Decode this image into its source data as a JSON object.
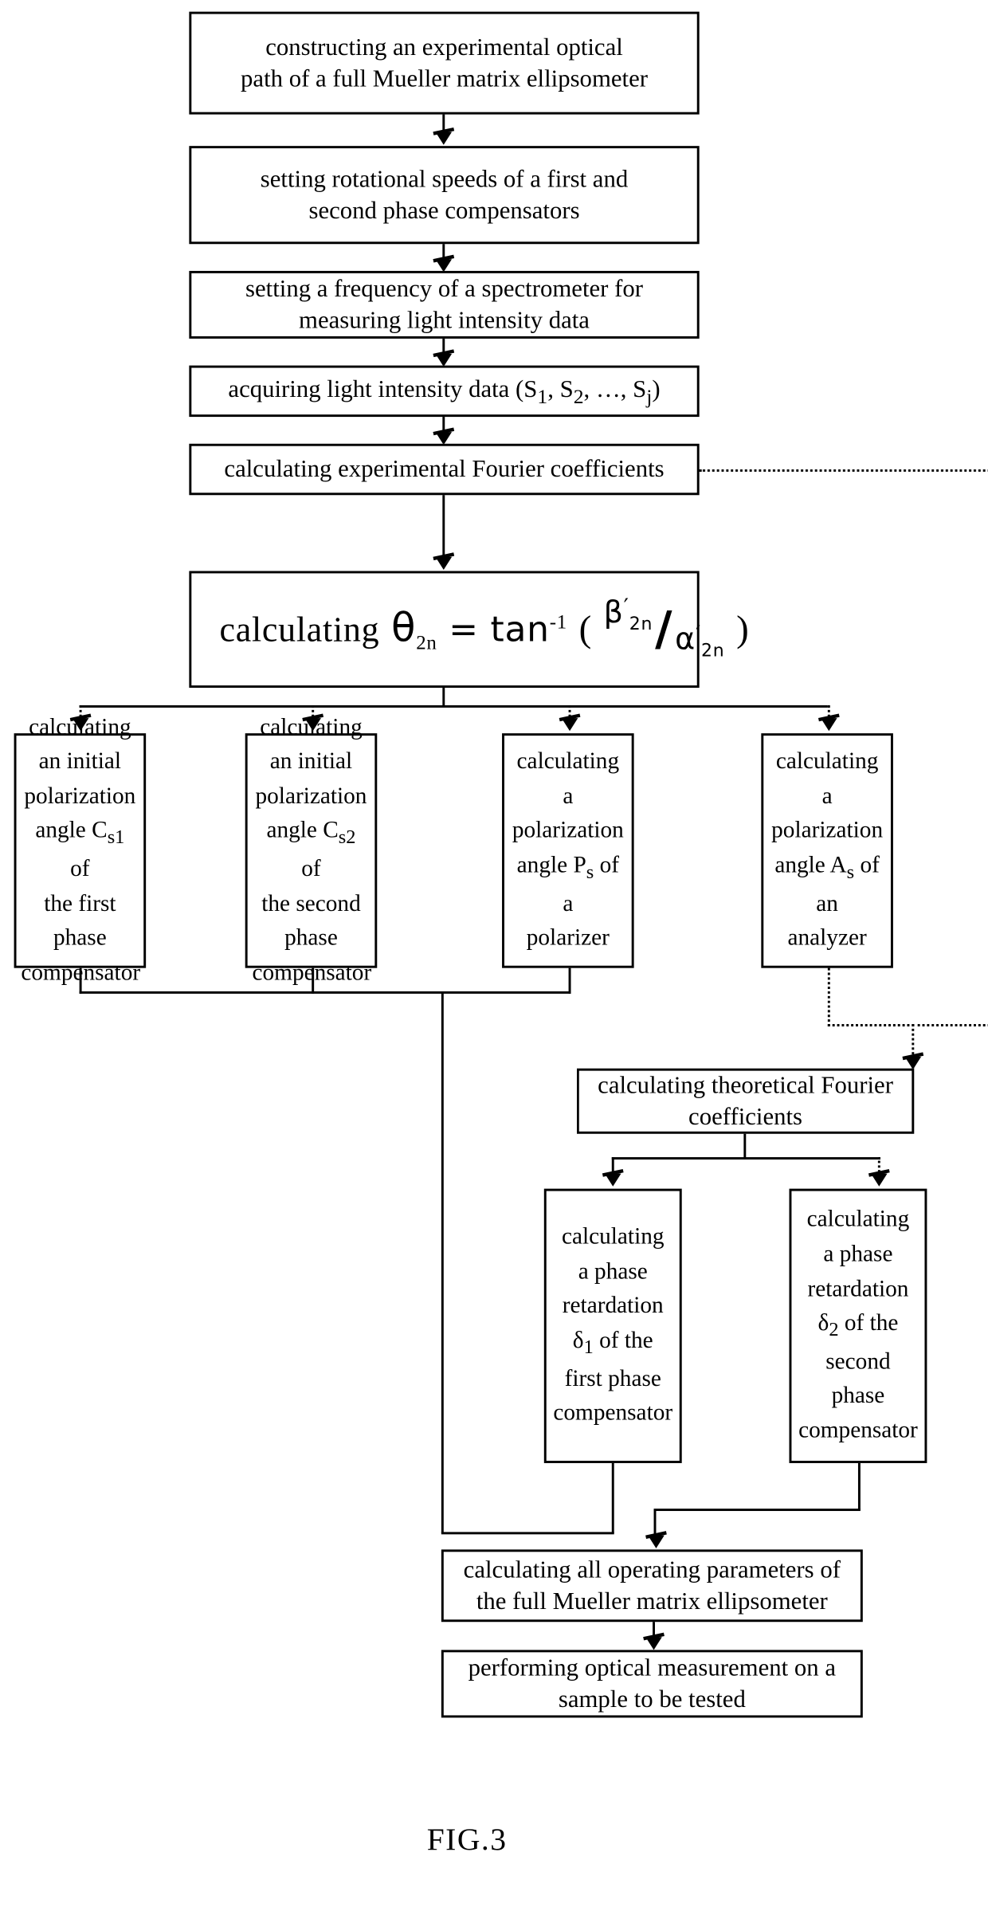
{
  "figure": {
    "caption": "FIG.3"
  },
  "nodes": {
    "construct": {
      "line1": "constructing an experimental optical",
      "line2": "path of a full Mueller matrix ellipsometer"
    },
    "set_speeds": {
      "line1": "setting rotational speeds of a first and",
      "line2": "second phase compensators"
    },
    "set_freq": {
      "line1": "setting a frequency of a spectrometer for",
      "line2": "measuring light intensity data"
    },
    "acquire": {
      "text": "acquiring light intensity data (S",
      "sub1": "1",
      "sep1": ", S",
      "sub2": "2",
      "sep2": ", …, S",
      "sub3": "j",
      "tail": ")"
    },
    "exp_fourier": {
      "text": "calculating experimental Fourier  coefficients"
    },
    "formula": {
      "label": "calculating",
      "theta": "θ",
      "theta_sub": "2n",
      "equals": "=",
      "tan": "tan",
      "tan_exp": "-1",
      "open_paren": "(",
      "numerator": "β",
      "numerator_prime": "′",
      "numerator_sub": "2n",
      "slash": "/",
      "denominator": "α",
      "denominator_prime": "′",
      "denominator_sub": "2n",
      "close_paren": ")"
    },
    "cs1": {
      "l1": "calculating",
      "l2": "an initial",
      "l3": "polarization",
      "l4": "angle C",
      "l4sub": "s1",
      "l5": "of",
      "l6": "the first",
      "l7": "phase",
      "l8": "compensator"
    },
    "cs2": {
      "l1": "calculating",
      "l2": "an initial",
      "l3": "polarization",
      "l4": "angle C",
      "l4sub": "s2",
      "l5": "of",
      "l6": "the second",
      "l7": "phase",
      "l8": "compensator"
    },
    "ps": {
      "l1": "calculating",
      "l2": "a",
      "l3": "polarization",
      "l4": "angle P",
      "l4sub": "s",
      "l5": "of",
      "l6": "a",
      "l7": "polarizer"
    },
    "as": {
      "l1": "calculating",
      "l2": "a",
      "l3": "polarization",
      "l4": "angle A",
      "l4sub": "s",
      "l5": "of",
      "l6": "an",
      "l7": "analyzer"
    },
    "theo_fourier": {
      "line1": "calculating theoretical Fourier",
      "line2": "coefficients"
    },
    "delta1": {
      "l1": "calculating",
      "l2": "a phase",
      "l3": "retardation",
      "l4": "δ",
      "l4sub": "1",
      "l4tail": " of the",
      "l5": "first phase",
      "l6": "compensator"
    },
    "delta2": {
      "l1": "calculating",
      "l2": "a phase",
      "l3": "retardation",
      "l4": "δ",
      "l4sub": "2",
      "l4tail": " of the",
      "l5": "second",
      "l6": "phase",
      "l7": "compensator"
    },
    "all_params": {
      "line1": "calculating all operating parameters of",
      "line2": "the full Mueller matrix ellipsometer"
    },
    "measure": {
      "line1": "performing optical measurement on a",
      "line2": "sample to be tested"
    }
  },
  "colors": {
    "stroke": "#000000",
    "background": "#ffffff"
  }
}
